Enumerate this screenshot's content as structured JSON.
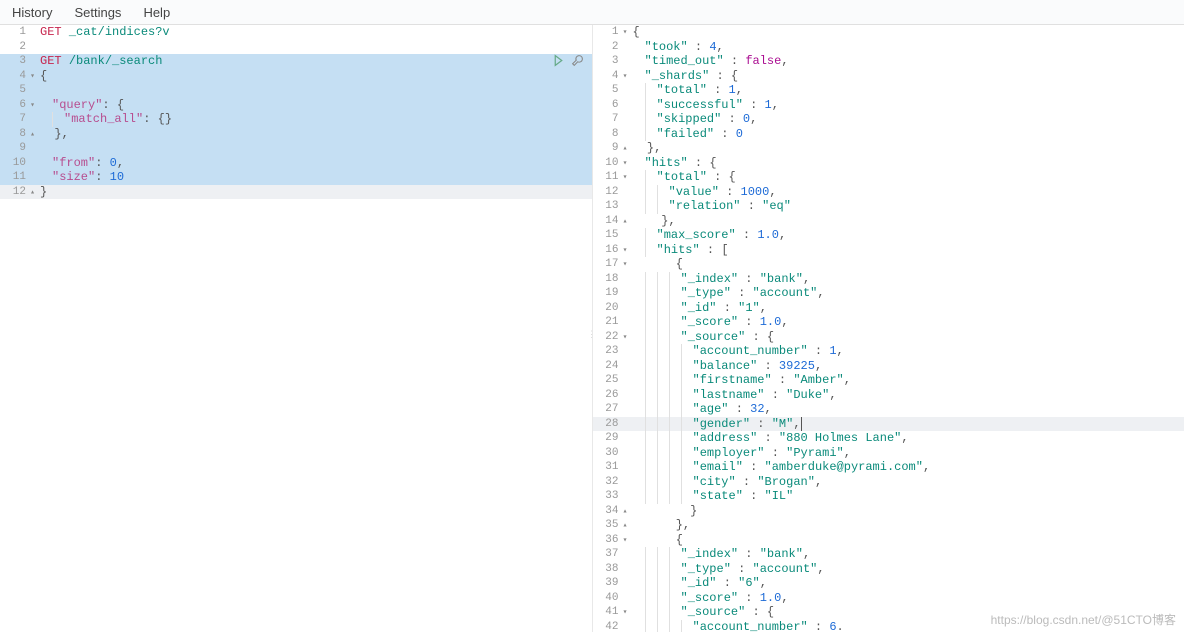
{
  "menu": {
    "history": "History",
    "settings": "Settings",
    "help": "Help"
  },
  "left": {
    "lines": [
      {
        "n": "1",
        "fold": "",
        "sel": false,
        "frags": [
          {
            "t": "GET ",
            "c": "method"
          },
          {
            "t": "_cat/indices?v",
            "c": "path"
          }
        ]
      },
      {
        "n": "2",
        "fold": "",
        "sel": false,
        "frags": []
      },
      {
        "n": "3",
        "fold": "",
        "sel": true,
        "icons": true,
        "frags": [
          {
            "t": "GET ",
            "c": "method"
          },
          {
            "t": "/bank/_search",
            "c": "path"
          }
        ]
      },
      {
        "n": "4",
        "fold": "▾",
        "sel": true,
        "frags": [
          {
            "t": "{",
            "c": "punc"
          }
        ]
      },
      {
        "n": "5",
        "fold": "",
        "sel": true,
        "frags": [
          {
            "t": "  ",
            "c": ""
          }
        ]
      },
      {
        "n": "6",
        "fold": "▾",
        "sel": true,
        "frags": [
          {
            "t": "  ",
            "c": ""
          },
          {
            "t": "\"query\"",
            "c": "key"
          },
          {
            "t": ": {",
            "c": "punc"
          }
        ]
      },
      {
        "n": "7",
        "fold": "",
        "sel": true,
        "frags": [
          {
            "t": "    ",
            "c": ""
          },
          {
            "t": "\"match_all\"",
            "c": "key"
          },
          {
            "t": ": {}",
            "c": "punc"
          }
        ]
      },
      {
        "n": "8",
        "fold": "▴",
        "sel": true,
        "frags": [
          {
            "t": "  },",
            "c": "punc"
          }
        ]
      },
      {
        "n": "9",
        "fold": "",
        "sel": true,
        "frags": [
          {
            "t": "  ",
            "c": ""
          }
        ]
      },
      {
        "n": "10",
        "fold": "",
        "sel": true,
        "frags": [
          {
            "t": "  ",
            "c": ""
          },
          {
            "t": "\"from\"",
            "c": "key"
          },
          {
            "t": ": ",
            "c": "punc"
          },
          {
            "t": "0",
            "c": "num"
          },
          {
            "t": ",",
            "c": "punc"
          }
        ]
      },
      {
        "n": "11",
        "fold": "",
        "sel": true,
        "frags": [
          {
            "t": "  ",
            "c": ""
          },
          {
            "t": "\"size\"",
            "c": "key"
          },
          {
            "t": ": ",
            "c": "punc"
          },
          {
            "t": "10",
            "c": "num"
          }
        ]
      },
      {
        "n": "12",
        "fold": "▴",
        "sel": false,
        "hl": true,
        "frags": [
          {
            "t": "}",
            "c": "punc"
          }
        ]
      }
    ]
  },
  "right": {
    "lines": [
      {
        "n": "1",
        "fold": "▾",
        "frags": [
          {
            "t": "{",
            "c": "punc"
          }
        ]
      },
      {
        "n": "2",
        "fold": "",
        "frags": [
          {
            "t": "  ",
            "c": ""
          },
          {
            "t": "\"took\"",
            "c": "keyR"
          },
          {
            "t": " : ",
            "c": "punc"
          },
          {
            "t": "4",
            "c": "num"
          },
          {
            "t": ",",
            "c": "punc"
          }
        ]
      },
      {
        "n": "3",
        "fold": "",
        "frags": [
          {
            "t": "  ",
            "c": ""
          },
          {
            "t": "\"timed_out\"",
            "c": "keyR"
          },
          {
            "t": " : ",
            "c": "punc"
          },
          {
            "t": "false",
            "c": "bool"
          },
          {
            "t": ",",
            "c": "punc"
          }
        ]
      },
      {
        "n": "4",
        "fold": "▾",
        "frags": [
          {
            "t": "  ",
            "c": ""
          },
          {
            "t": "\"_shards\"",
            "c": "keyR"
          },
          {
            "t": " : {",
            "c": "punc"
          }
        ]
      },
      {
        "n": "5",
        "fold": "",
        "frags": [
          {
            "t": "    ",
            "c": ""
          },
          {
            "t": "\"total\"",
            "c": "keyR"
          },
          {
            "t": " : ",
            "c": "punc"
          },
          {
            "t": "1",
            "c": "num"
          },
          {
            "t": ",",
            "c": "punc"
          }
        ]
      },
      {
        "n": "6",
        "fold": "",
        "frags": [
          {
            "t": "    ",
            "c": ""
          },
          {
            "t": "\"successful\"",
            "c": "keyR"
          },
          {
            "t": " : ",
            "c": "punc"
          },
          {
            "t": "1",
            "c": "num"
          },
          {
            "t": ",",
            "c": "punc"
          }
        ]
      },
      {
        "n": "7",
        "fold": "",
        "frags": [
          {
            "t": "    ",
            "c": ""
          },
          {
            "t": "\"skipped\"",
            "c": "keyR"
          },
          {
            "t": " : ",
            "c": "punc"
          },
          {
            "t": "0",
            "c": "num"
          },
          {
            "t": ",",
            "c": "punc"
          }
        ]
      },
      {
        "n": "8",
        "fold": "",
        "frags": [
          {
            "t": "    ",
            "c": ""
          },
          {
            "t": "\"failed\"",
            "c": "keyR"
          },
          {
            "t": " : ",
            "c": "punc"
          },
          {
            "t": "0",
            "c": "num"
          }
        ]
      },
      {
        "n": "9",
        "fold": "▴",
        "frags": [
          {
            "t": "  },",
            "c": "punc"
          }
        ]
      },
      {
        "n": "10",
        "fold": "▾",
        "frags": [
          {
            "t": "  ",
            "c": ""
          },
          {
            "t": "\"hits\"",
            "c": "keyR"
          },
          {
            "t": " : {",
            "c": "punc"
          }
        ]
      },
      {
        "n": "11",
        "fold": "▾",
        "frags": [
          {
            "t": "    ",
            "c": ""
          },
          {
            "t": "\"total\"",
            "c": "keyR"
          },
          {
            "t": " : {",
            "c": "punc"
          }
        ]
      },
      {
        "n": "12",
        "fold": "",
        "frags": [
          {
            "t": "      ",
            "c": ""
          },
          {
            "t": "\"value\"",
            "c": "keyR"
          },
          {
            "t": " : ",
            "c": "punc"
          },
          {
            "t": "1000",
            "c": "num"
          },
          {
            "t": ",",
            "c": "punc"
          }
        ]
      },
      {
        "n": "13",
        "fold": "",
        "frags": [
          {
            "t": "      ",
            "c": ""
          },
          {
            "t": "\"relation\"",
            "c": "keyR"
          },
          {
            "t": " : ",
            "c": "punc"
          },
          {
            "t": "\"eq\"",
            "c": "str"
          }
        ]
      },
      {
        "n": "14",
        "fold": "▴",
        "frags": [
          {
            "t": "    },",
            "c": "punc"
          }
        ]
      },
      {
        "n": "15",
        "fold": "",
        "frags": [
          {
            "t": "    ",
            "c": ""
          },
          {
            "t": "\"max_score\"",
            "c": "keyR"
          },
          {
            "t": " : ",
            "c": "punc"
          },
          {
            "t": "1.0",
            "c": "num"
          },
          {
            "t": ",",
            "c": "punc"
          }
        ]
      },
      {
        "n": "16",
        "fold": "▾",
        "frags": [
          {
            "t": "    ",
            "c": ""
          },
          {
            "t": "\"hits\"",
            "c": "keyR"
          },
          {
            "t": " : [",
            "c": "punc"
          }
        ]
      },
      {
        "n": "17",
        "fold": "▾",
        "frags": [
          {
            "t": "      {",
            "c": "punc"
          }
        ]
      },
      {
        "n": "18",
        "fold": "",
        "frags": [
          {
            "t": "        ",
            "c": ""
          },
          {
            "t": "\"_index\"",
            "c": "keyR"
          },
          {
            "t": " : ",
            "c": "punc"
          },
          {
            "t": "\"bank\"",
            "c": "str"
          },
          {
            "t": ",",
            "c": "punc"
          }
        ]
      },
      {
        "n": "19",
        "fold": "",
        "frags": [
          {
            "t": "        ",
            "c": ""
          },
          {
            "t": "\"_type\"",
            "c": "keyR"
          },
          {
            "t": " : ",
            "c": "punc"
          },
          {
            "t": "\"account\"",
            "c": "str"
          },
          {
            "t": ",",
            "c": "punc"
          }
        ]
      },
      {
        "n": "20",
        "fold": "",
        "frags": [
          {
            "t": "        ",
            "c": ""
          },
          {
            "t": "\"_id\"",
            "c": "keyR"
          },
          {
            "t": " : ",
            "c": "punc"
          },
          {
            "t": "\"1\"",
            "c": "str"
          },
          {
            "t": ",",
            "c": "punc"
          }
        ]
      },
      {
        "n": "21",
        "fold": "",
        "frags": [
          {
            "t": "        ",
            "c": ""
          },
          {
            "t": "\"_score\"",
            "c": "keyR"
          },
          {
            "t": " : ",
            "c": "punc"
          },
          {
            "t": "1.0",
            "c": "num"
          },
          {
            "t": ",",
            "c": "punc"
          }
        ]
      },
      {
        "n": "22",
        "fold": "▾",
        "frags": [
          {
            "t": "        ",
            "c": ""
          },
          {
            "t": "\"_source\"",
            "c": "keyR"
          },
          {
            "t": " : {",
            "c": "punc"
          }
        ]
      },
      {
        "n": "23",
        "fold": "",
        "frags": [
          {
            "t": "          ",
            "c": ""
          },
          {
            "t": "\"account_number\"",
            "c": "keyR"
          },
          {
            "t": " : ",
            "c": "punc"
          },
          {
            "t": "1",
            "c": "num"
          },
          {
            "t": ",",
            "c": "punc"
          }
        ]
      },
      {
        "n": "24",
        "fold": "",
        "frags": [
          {
            "t": "          ",
            "c": ""
          },
          {
            "t": "\"balance\"",
            "c": "keyR"
          },
          {
            "t": " : ",
            "c": "punc"
          },
          {
            "t": "39225",
            "c": "num"
          },
          {
            "t": ",",
            "c": "punc"
          }
        ]
      },
      {
        "n": "25",
        "fold": "",
        "frags": [
          {
            "t": "          ",
            "c": ""
          },
          {
            "t": "\"firstname\"",
            "c": "keyR"
          },
          {
            "t": " : ",
            "c": "punc"
          },
          {
            "t": "\"Amber\"",
            "c": "str"
          },
          {
            "t": ",",
            "c": "punc"
          }
        ]
      },
      {
        "n": "26",
        "fold": "",
        "frags": [
          {
            "t": "          ",
            "c": ""
          },
          {
            "t": "\"lastname\"",
            "c": "keyR"
          },
          {
            "t": " : ",
            "c": "punc"
          },
          {
            "t": "\"Duke\"",
            "c": "str"
          },
          {
            "t": ",",
            "c": "punc"
          }
        ]
      },
      {
        "n": "27",
        "fold": "",
        "frags": [
          {
            "t": "          ",
            "c": ""
          },
          {
            "t": "\"age\"",
            "c": "keyR"
          },
          {
            "t": " : ",
            "c": "punc"
          },
          {
            "t": "32",
            "c": "num"
          },
          {
            "t": ",",
            "c": "punc"
          }
        ]
      },
      {
        "n": "28",
        "fold": "",
        "hl": true,
        "frags": [
          {
            "t": "          ",
            "c": ""
          },
          {
            "t": "\"gender\"",
            "c": "keyR"
          },
          {
            "t": " : ",
            "c": "punc"
          },
          {
            "t": "\"M\"",
            "c": "str"
          },
          {
            "t": ",",
            "c": "punc cursor-bar"
          }
        ]
      },
      {
        "n": "29",
        "fold": "",
        "frags": [
          {
            "t": "          ",
            "c": ""
          },
          {
            "t": "\"address\"",
            "c": "keyR"
          },
          {
            "t": " : ",
            "c": "punc"
          },
          {
            "t": "\"880 Holmes Lane\"",
            "c": "str"
          },
          {
            "t": ",",
            "c": "punc"
          }
        ]
      },
      {
        "n": "30",
        "fold": "",
        "frags": [
          {
            "t": "          ",
            "c": ""
          },
          {
            "t": "\"employer\"",
            "c": "keyR"
          },
          {
            "t": " : ",
            "c": "punc"
          },
          {
            "t": "\"Pyrami\"",
            "c": "str"
          },
          {
            "t": ",",
            "c": "punc"
          }
        ]
      },
      {
        "n": "31",
        "fold": "",
        "frags": [
          {
            "t": "          ",
            "c": ""
          },
          {
            "t": "\"email\"",
            "c": "keyR"
          },
          {
            "t": " : ",
            "c": "punc"
          },
          {
            "t": "\"amberduke@pyrami.com\"",
            "c": "str"
          },
          {
            "t": ",",
            "c": "punc"
          }
        ]
      },
      {
        "n": "32",
        "fold": "",
        "frags": [
          {
            "t": "          ",
            "c": ""
          },
          {
            "t": "\"city\"",
            "c": "keyR"
          },
          {
            "t": " : ",
            "c": "punc"
          },
          {
            "t": "\"Brogan\"",
            "c": "str"
          },
          {
            "t": ",",
            "c": "punc"
          }
        ]
      },
      {
        "n": "33",
        "fold": "",
        "frags": [
          {
            "t": "          ",
            "c": ""
          },
          {
            "t": "\"state\"",
            "c": "keyR"
          },
          {
            "t": " : ",
            "c": "punc"
          },
          {
            "t": "\"IL\"",
            "c": "str"
          }
        ]
      },
      {
        "n": "34",
        "fold": "▴",
        "frags": [
          {
            "t": "        }",
            "c": "punc"
          }
        ]
      },
      {
        "n": "35",
        "fold": "▴",
        "frags": [
          {
            "t": "      },",
            "c": "punc"
          }
        ]
      },
      {
        "n": "36",
        "fold": "▾",
        "frags": [
          {
            "t": "      {",
            "c": "punc"
          }
        ]
      },
      {
        "n": "37",
        "fold": "",
        "frags": [
          {
            "t": "        ",
            "c": ""
          },
          {
            "t": "\"_index\"",
            "c": "keyR"
          },
          {
            "t": " : ",
            "c": "punc"
          },
          {
            "t": "\"bank\"",
            "c": "str"
          },
          {
            "t": ",",
            "c": "punc"
          }
        ]
      },
      {
        "n": "38",
        "fold": "",
        "frags": [
          {
            "t": "        ",
            "c": ""
          },
          {
            "t": "\"_type\"",
            "c": "keyR"
          },
          {
            "t": " : ",
            "c": "punc"
          },
          {
            "t": "\"account\"",
            "c": "str"
          },
          {
            "t": ",",
            "c": "punc"
          }
        ]
      },
      {
        "n": "39",
        "fold": "",
        "frags": [
          {
            "t": "        ",
            "c": ""
          },
          {
            "t": "\"_id\"",
            "c": "keyR"
          },
          {
            "t": " : ",
            "c": "punc"
          },
          {
            "t": "\"6\"",
            "c": "str"
          },
          {
            "t": ",",
            "c": "punc"
          }
        ]
      },
      {
        "n": "40",
        "fold": "",
        "frags": [
          {
            "t": "        ",
            "c": ""
          },
          {
            "t": "\"_score\"",
            "c": "keyR"
          },
          {
            "t": " : ",
            "c": "punc"
          },
          {
            "t": "1.0",
            "c": "num"
          },
          {
            "t": ",",
            "c": "punc"
          }
        ]
      },
      {
        "n": "41",
        "fold": "▾",
        "frags": [
          {
            "t": "        ",
            "c": ""
          },
          {
            "t": "\"_source\"",
            "c": "keyR"
          },
          {
            "t": " : {",
            "c": "punc"
          }
        ]
      },
      {
        "n": "42",
        "fold": "",
        "frags": [
          {
            "t": "          ",
            "c": ""
          },
          {
            "t": "\"account_number\"",
            "c": "keyR"
          },
          {
            "t": " : ",
            "c": "punc"
          },
          {
            "t": "6",
            "c": "num"
          },
          {
            "t": ".",
            "c": "punc"
          }
        ]
      }
    ]
  },
  "watermark": "https://blog.csdn.net/@51CTO博客"
}
